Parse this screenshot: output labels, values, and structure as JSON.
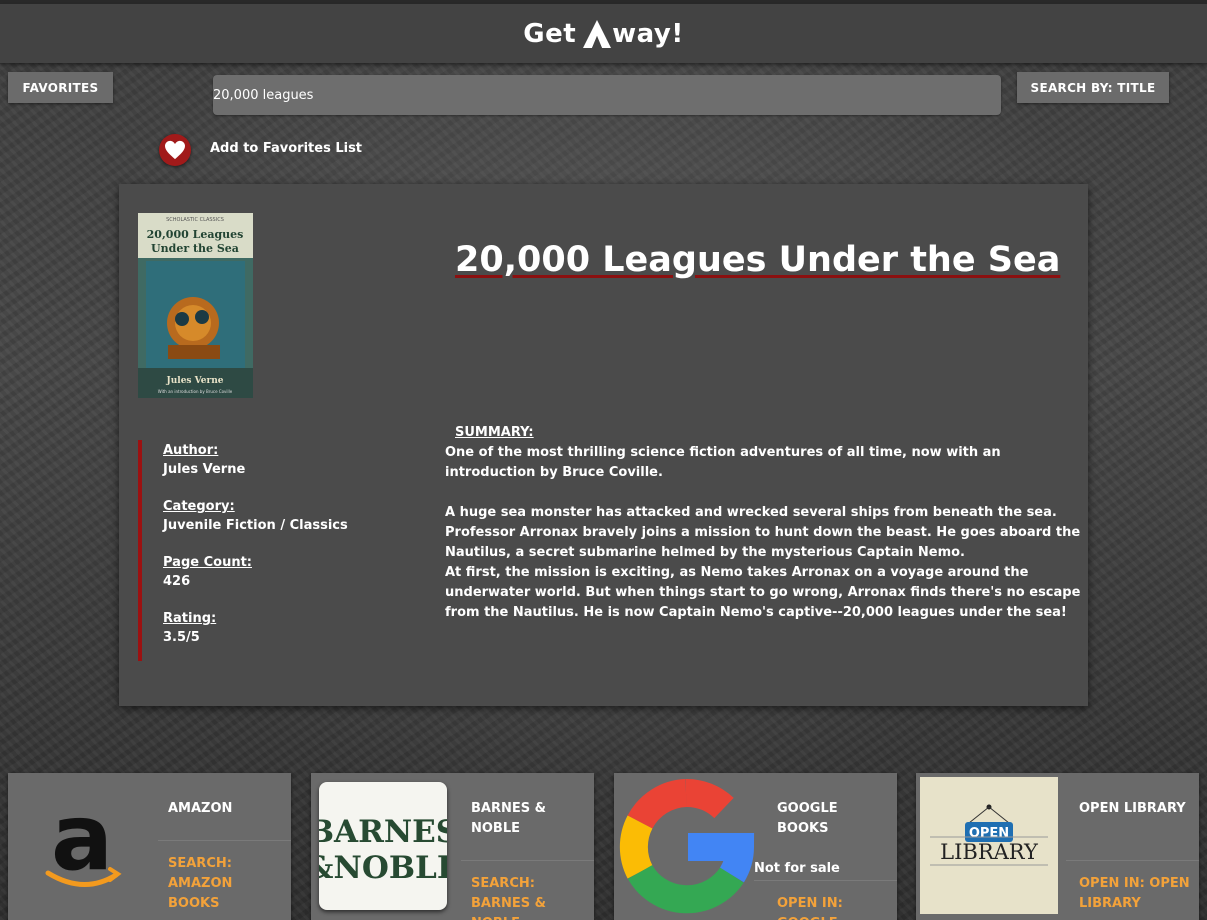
{
  "header": {
    "logo_text_left": "Get",
    "logo_text_right": "way!"
  },
  "toolbar": {
    "favorites_label": "FAVORITES",
    "search_by_label": "SEARCH BY: TITLE"
  },
  "search": {
    "value": "20,000 leagues"
  },
  "favorites": {
    "add_label": "Add to Favorites List"
  },
  "book": {
    "cover": {
      "series": "SCHOLASTIC CLASSICS",
      "title_line1": "20,000 Leagues",
      "title_line2": "Under the Sea",
      "author": "Jules Verne",
      "intro": "With an introduction by Bruce Coville"
    },
    "title": "20,000 Leagues Under the Sea",
    "author_label": "Author:",
    "author": "Jules Verne",
    "category_label": "Category:",
    "category": "Juvenile Fiction / Classics",
    "page_count_label": "Page Count:",
    "page_count": "426",
    "rating_label": "Rating:",
    "rating": "3.5/5",
    "summary_label": "SUMMARY:",
    "summary_p1": "One of the most thrilling science fiction adventures of all time, now with an introduction by Bruce Coville.",
    "summary_p2": "A huge sea monster has attacked and wrecked several ships from beneath the sea. Professor Arronax bravely joins a mission to hunt down the beast. He goes aboard the Nautilus, a secret submarine helmed by the mysterious Captain Nemo.",
    "summary_p3": "At first, the mission is exciting, as Nemo takes Arronax on a voyage around the underwater world. But when things start to go wrong, Arronax finds there's no escape from the Nautilus. He is now Captain Nemo's captive--20,000 leagues under the sea!"
  },
  "stores": [
    {
      "name": "AMAZON",
      "link": "SEARCH: AMAZON BOOKS"
    },
    {
      "name": "BARNES & NOBLE",
      "link": "SEARCH: BARNES & NOBLE",
      "logo_line1": "BARNES",
      "logo_line2": "&NOBLE"
    },
    {
      "name": "GOOGLE BOOKS",
      "note": "Not for sale",
      "link": "OPEN IN: GOOGLE BOOKS"
    },
    {
      "name": "OPEN LIBRARY",
      "link": "OPEN IN: OPEN LIBRARY",
      "logo_badge": "OPEN",
      "logo_word": "LIBRARY"
    }
  ],
  "colors": {
    "accent_red": "#9b1111",
    "link_orange": "#f3a23a",
    "panel": "#4b4b4b",
    "button": "#6b6b6b"
  }
}
